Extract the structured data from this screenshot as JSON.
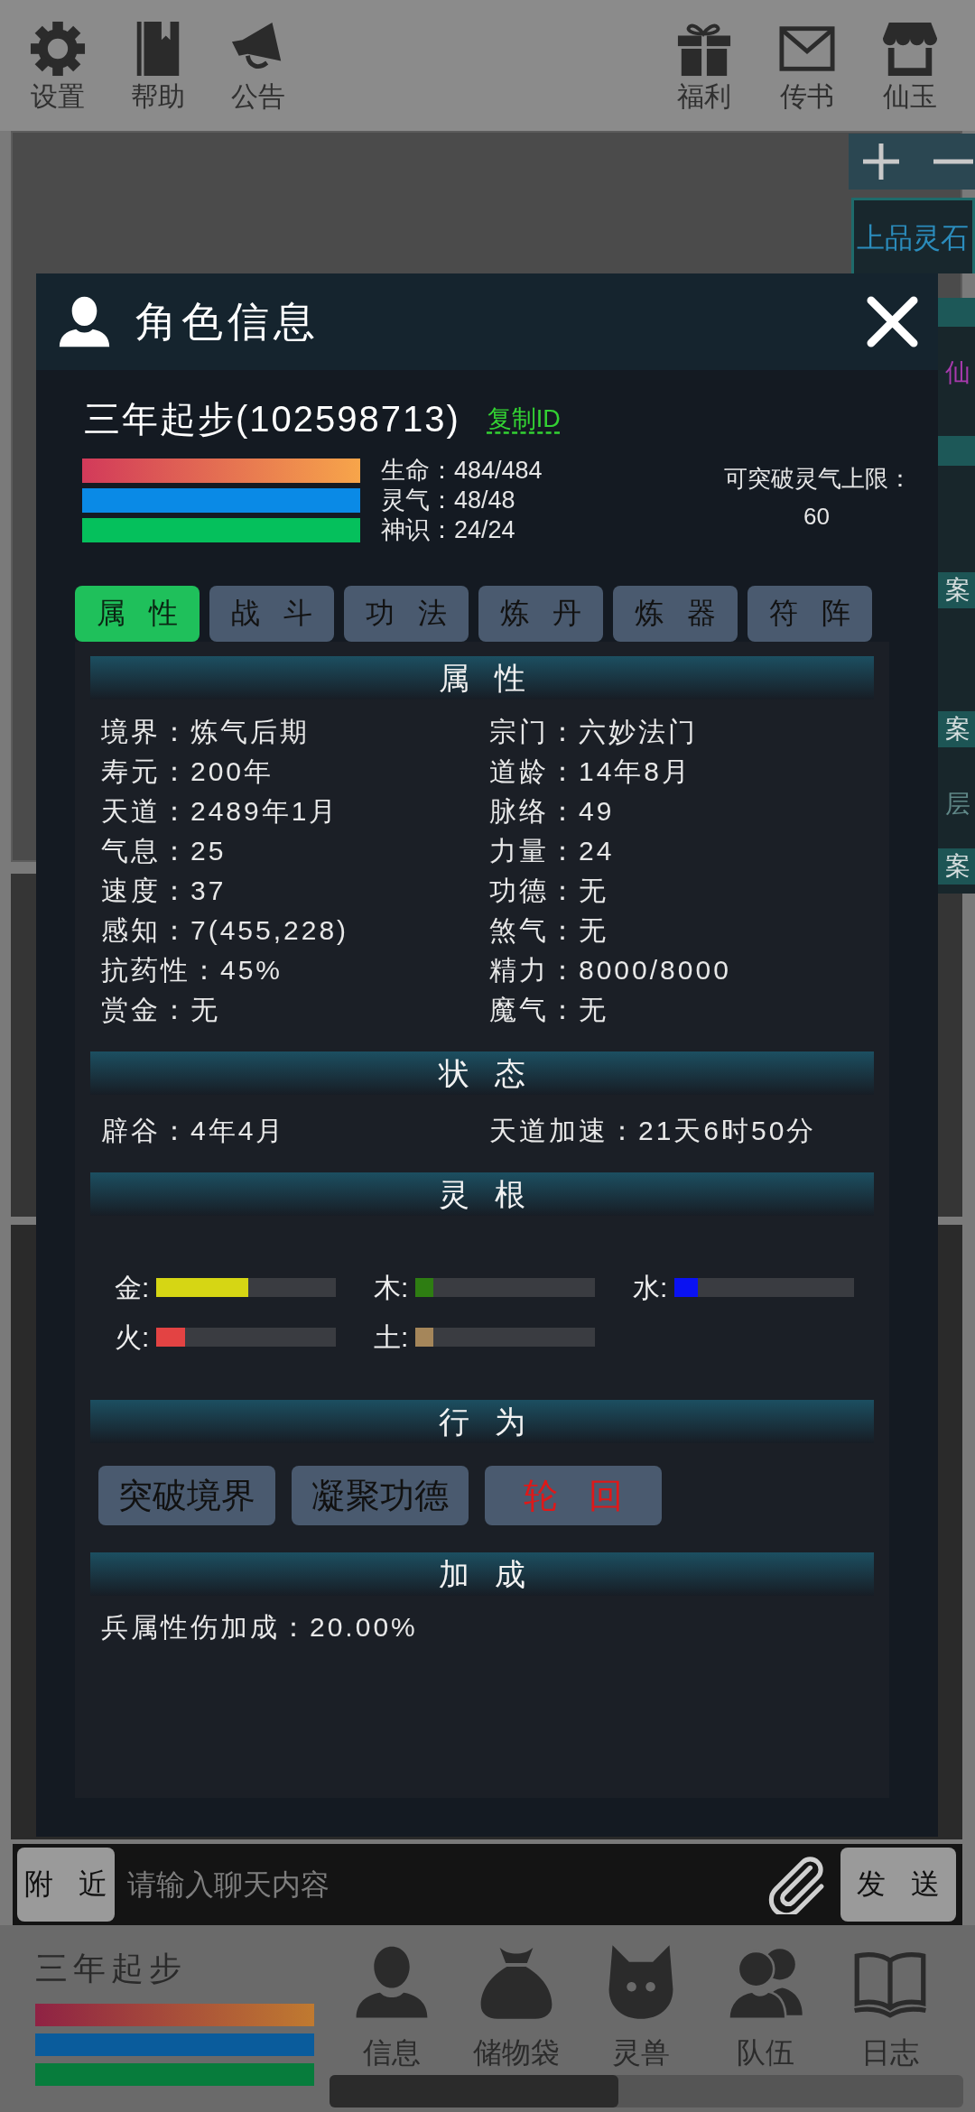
{
  "top_bar": {
    "left_items": [
      {
        "label": "设置"
      },
      {
        "label": "帮助"
      },
      {
        "label": "公告"
      }
    ],
    "right_items": [
      {
        "label": "福利"
      },
      {
        "label": "传书"
      },
      {
        "label": "仙玉"
      }
    ]
  },
  "side_panel": {
    "item_name": "上品灵石",
    "fragments": [
      {
        "kind": "text",
        "text": "仙",
        "color": "#a83aae"
      },
      {
        "kind": "tag",
        "text": "案"
      },
      {
        "kind": "tag",
        "text": "案"
      },
      {
        "kind": "text",
        "text": "层",
        "color": "#5f8787"
      },
      {
        "kind": "tag",
        "text": "案"
      }
    ]
  },
  "dialog": {
    "title": "角色信息",
    "character": {
      "name": "三年起步(102598713)",
      "copy_link": "复制ID"
    },
    "stats": [
      {
        "label": "生命：484/484",
        "level": 1,
        "kind": "gradient"
      },
      {
        "label": "灵气：48/48",
        "level": 1,
        "kind": "solid",
        "color": "#0a8ae6"
      },
      {
        "label": "神识：24/24",
        "level": 1,
        "kind": "solid",
        "color": "#05c05c"
      }
    ],
    "breakthrough": {
      "label": "可突破灵气上限：",
      "value": "60"
    },
    "tabs": [
      {
        "label": "属性",
        "selected": true
      },
      {
        "label": "战斗",
        "selected": false
      },
      {
        "label": "功法",
        "selected": false
      },
      {
        "label": "炼丹",
        "selected": false
      },
      {
        "label": "炼器",
        "selected": false
      },
      {
        "label": "符阵",
        "selected": false
      }
    ],
    "sections": [
      {
        "kind": "attributes",
        "title": "属性",
        "items": [
          "境界：炼气后期",
          "宗门：六妙法门",
          "寿元：200年",
          "道龄：14年8月",
          "天道：2489年1月",
          "脉络：49",
          "气息：25",
          "力量：24",
          "速度：37",
          "功德：无",
          "感知：7(455,228)",
          "煞气：无",
          "抗药性：45%",
          "精力：8000/8000",
          "赏金：无",
          "魔气：无"
        ]
      },
      {
        "kind": "status",
        "title": "状态",
        "items": [
          "辟谷：4年4月",
          "天道加速：21天6时50分"
        ]
      },
      {
        "kind": "roots",
        "title": "灵根",
        "items": [
          {
            "label": "金:",
            "level": 0.51,
            "color": "#d6d614"
          },
          {
            "label": "木:",
            "level": 0.1,
            "color": "#2e7d12"
          },
          {
            "label": "水:",
            "level": 0.13,
            "color": "#0a12f2"
          },
          {
            "label": "火:",
            "level": 0.16,
            "color": "#e34343"
          },
          {
            "label": "土:",
            "level": 0.1,
            "color": "#a5865a"
          }
        ]
      },
      {
        "kind": "actions",
        "title": "行为",
        "buttons": [
          {
            "label": "突破境界",
            "kind": "normal"
          },
          {
            "label": "凝聚功德",
            "kind": "normal"
          },
          {
            "label": "轮回",
            "kind": "danger"
          }
        ]
      },
      {
        "kind": "bonus",
        "title": "加成",
        "items": [
          "兵属性伤加成：20.00%"
        ]
      }
    ]
  },
  "chat_bar": {
    "channel": "附近",
    "placeholder": "请输入聊天内容",
    "send": "发送"
  },
  "hud": {
    "name": "三年起步",
    "bars": [
      {
        "level": 1,
        "kind": "gradient"
      },
      {
        "level": 1,
        "kind": "solid",
        "color": "#0a5c9c"
      },
      {
        "level": 1,
        "kind": "solid",
        "color": "#077c3c"
      }
    ],
    "nav": [
      {
        "label": "信息"
      },
      {
        "label": "储物袋"
      },
      {
        "label": "灵兽"
      },
      {
        "label": "队伍"
      },
      {
        "label": "日志"
      }
    ]
  }
}
